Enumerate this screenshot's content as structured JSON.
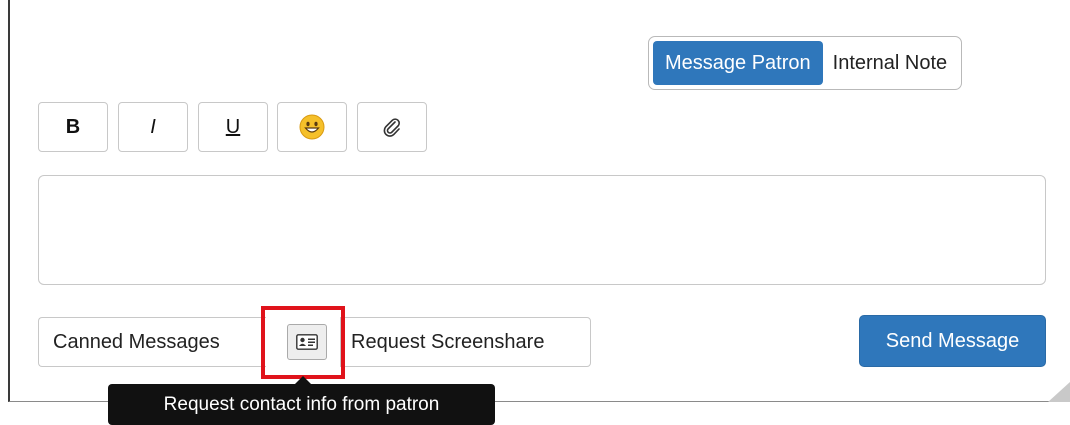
{
  "mode_toggle": {
    "options": [
      {
        "label": "Message Patron",
        "active": true
      },
      {
        "label": "Internal Note",
        "active": false
      }
    ]
  },
  "toolbar": {
    "bold_label": "B",
    "italic_label": "I",
    "underline_label": "U",
    "emoji_icon": "smiley-emoji-icon",
    "attach_icon": "paperclip-icon"
  },
  "message": {
    "value": "",
    "placeholder": ""
  },
  "actions": {
    "canned_label": "Canned Messages",
    "contact_icon": "contact-card-icon",
    "screenshare_label": "Request Screenshare",
    "send_label": "Send Message"
  },
  "tooltip": {
    "text": "Request contact info from patron"
  },
  "colors": {
    "accent": "#2f77bb",
    "highlight": "#e0131b",
    "tooltip_bg": "#111111"
  }
}
